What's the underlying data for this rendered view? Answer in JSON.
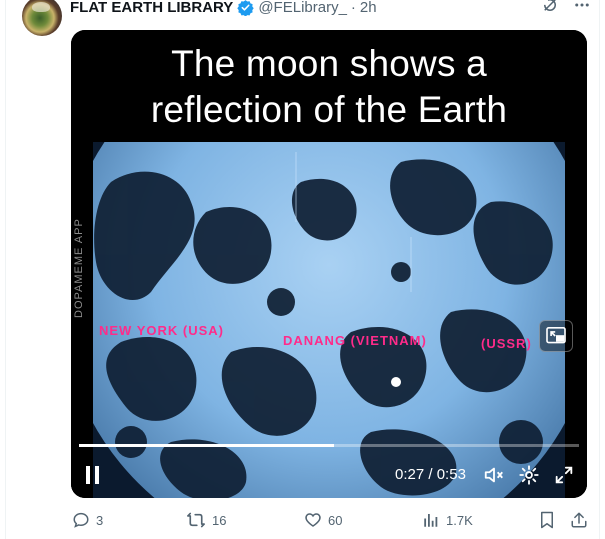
{
  "post": {
    "author_name": "FLAT EARTH LIBRARY",
    "handle": "@FELibrary_",
    "separator": "·",
    "time": "2h"
  },
  "video": {
    "caption_line1": "The moon shows a",
    "caption_line2": "reflection of the Earth",
    "watermark": "DOPAMEME APP",
    "overlay_labels": [
      "NEW YORK (USA)",
      "DANANG (VIETNAM)",
      "(USSR)"
    ],
    "current_time": "0:27",
    "time_separator": "/",
    "duration": "0:53",
    "progress": 0.51
  },
  "actions": {
    "replies": "3",
    "reposts": "16",
    "likes": "60",
    "views": "1.7K"
  },
  "colors": {
    "accent_blue": "#1d9bf0",
    "muted_text": "#536471",
    "overlay_pink": "#ff2b8a",
    "moon_blue": "#7fb4e3"
  }
}
